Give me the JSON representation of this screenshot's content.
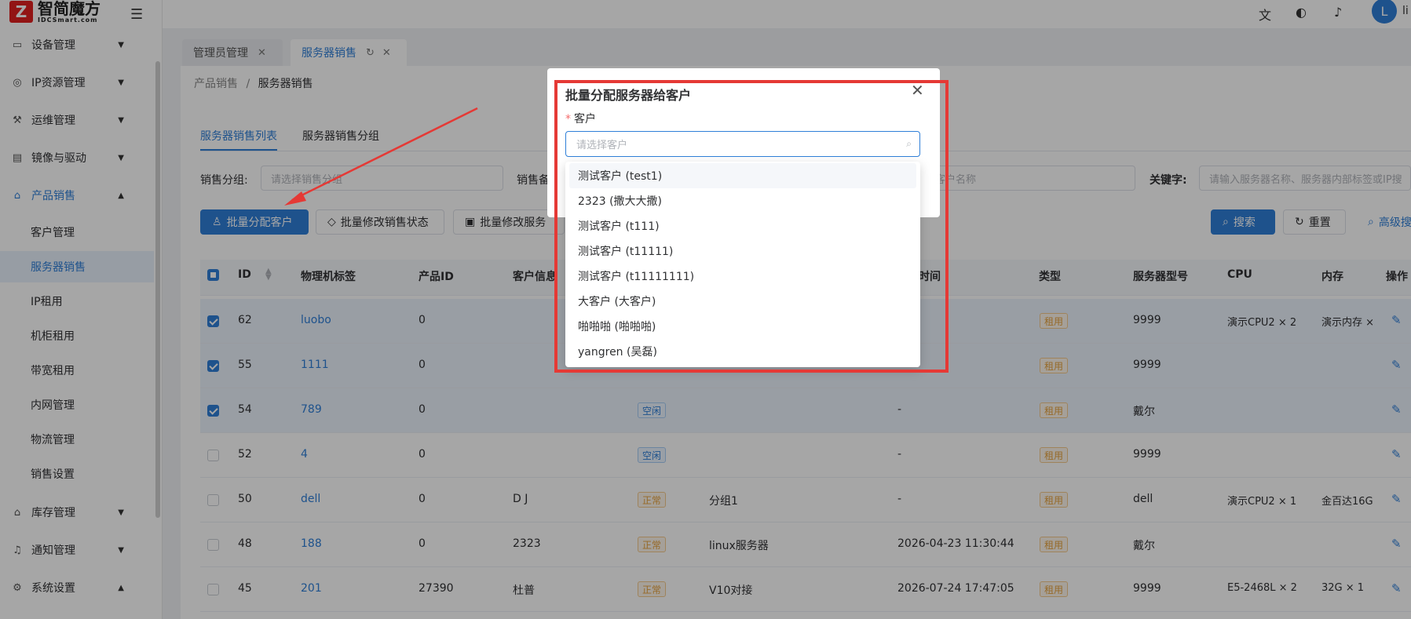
{
  "brand": {
    "name_cn": "智简魔方",
    "name_en": "IDCSmart.com",
    "logo_letter": "Z",
    "color": "#e02020"
  },
  "sidebar": {
    "items": [
      {
        "label": "设备管理",
        "icon": "monitor-icon"
      },
      {
        "label": "IP资源管理",
        "icon": "globe-icon"
      },
      {
        "label": "运维管理",
        "icon": "wrench-icon"
      },
      {
        "label": "镜像与驱动",
        "icon": "disk-icon"
      },
      {
        "label": "产品销售",
        "icon": "bag-icon",
        "expanded": true,
        "active": true
      },
      {
        "label": "库存管理",
        "icon": "warehouse-icon"
      },
      {
        "label": "通知管理",
        "icon": "bell-icon"
      },
      {
        "label": "系统设置",
        "icon": "gear-icon",
        "expanded": true
      }
    ],
    "sub_items": [
      "客户管理",
      "服务器销售",
      "IP租用",
      "机柜租用",
      "带宽租用",
      "内网管理",
      "物流管理",
      "销售设置"
    ],
    "active_sub": "服务器销售"
  },
  "topbar": {
    "icons": [
      "translate-icon",
      "palette-icon",
      "bell-icon"
    ],
    "avatar_letter": "L",
    "user_initial_text": "li"
  },
  "tabs": [
    {
      "label": "管理员管理",
      "active": false
    },
    {
      "label": "服务器销售",
      "active": true
    }
  ],
  "breadcrumb": {
    "parent": "产品销售",
    "sep": "/",
    "current": "服务器销售"
  },
  "subtabs": [
    "服务器销售列表",
    "服务器销售分组"
  ],
  "filters": {
    "group_label": "销售分组:",
    "group_placeholder": "请选择销售分组",
    "note_label": "销售备",
    "customer_placeholder": "客户名称",
    "keyword_label": "关键字:",
    "keyword_placeholder": "请输入服务器名称、服务器内部标签或IP搜"
  },
  "actions": {
    "assign": "批量分配客户",
    "change_status": "批量修改销售状态",
    "change_server": "批量修改服务",
    "search": "搜索",
    "reset": "重置",
    "advanced": "高级搜"
  },
  "table": {
    "headers": [
      "ID",
      "物理机标签",
      "产品ID",
      "客户信息",
      "时间",
      "类型",
      "服务器型号",
      "CPU",
      "内存",
      "操作"
    ],
    "rows": [
      {
        "id": "62",
        "tag": "luobo",
        "pid": "0",
        "customer": "",
        "status": "",
        "group": "",
        "time": "",
        "type": "租用",
        "model": "9999",
        "cpu": "演示CPU2 × 2",
        "mem": "演示内存 ×",
        "selected": true
      },
      {
        "id": "55",
        "tag": "1111",
        "pid": "0",
        "customer": "",
        "status": "",
        "group": "",
        "time": "",
        "type": "租用",
        "model": "9999",
        "cpu": "",
        "mem": "",
        "selected": true
      },
      {
        "id": "54",
        "tag": "789",
        "pid": "0",
        "customer": "",
        "status": "空闲",
        "group": "",
        "time": "-",
        "type": "租用",
        "model": "戴尔",
        "cpu": "",
        "mem": "",
        "selected": true
      },
      {
        "id": "52",
        "tag": "4",
        "pid": "0",
        "customer": "",
        "status": "空闲",
        "group": "",
        "time": "-",
        "type": "租用",
        "model": "9999",
        "cpu": "",
        "mem": "",
        "selected": false
      },
      {
        "id": "50",
        "tag": "dell",
        "pid": "0",
        "customer": "D J",
        "status": "正常",
        "group": "分组1",
        "time": "-",
        "type": "租用",
        "model": "dell",
        "cpu": "演示CPU2 × 1",
        "mem": "金百达16G",
        "selected": false
      },
      {
        "id": "48",
        "tag": "188",
        "pid": "0",
        "customer": "2323",
        "status": "正常",
        "group": "linux服务器",
        "time": "2026-04-23 11:30:44",
        "type": "租用",
        "model": "戴尔",
        "cpu": "",
        "mem": "",
        "selected": false
      },
      {
        "id": "45",
        "tag": "201",
        "pid": "27390",
        "customer": "杜普",
        "status": "正常",
        "group": "V10对接",
        "time": "2026-07-24 17:47:05",
        "type": "租用",
        "model": "9999",
        "cpu": "E5-2468L × 2",
        "mem": "32G × 1",
        "selected": false
      }
    ]
  },
  "dialog": {
    "title": "批量分配服务器给客户",
    "field_label": "客户",
    "required_mark": "*",
    "placeholder": "请选择客户",
    "options": [
      "测试客户 (test1)",
      "2323 (撒大大撒)",
      "测试客户 (t111)",
      "测试客户 (t11111)",
      "测试客户 (t11111111)",
      "大客户 (大客户)",
      "啪啪啪 (啪啪啪)",
      "yangren (吴磊)"
    ],
    "hovered_option": 0
  },
  "colors": {
    "primary": "#2f7fd8",
    "annotation": "#e53935",
    "tag_orange": "#e6a23c"
  }
}
